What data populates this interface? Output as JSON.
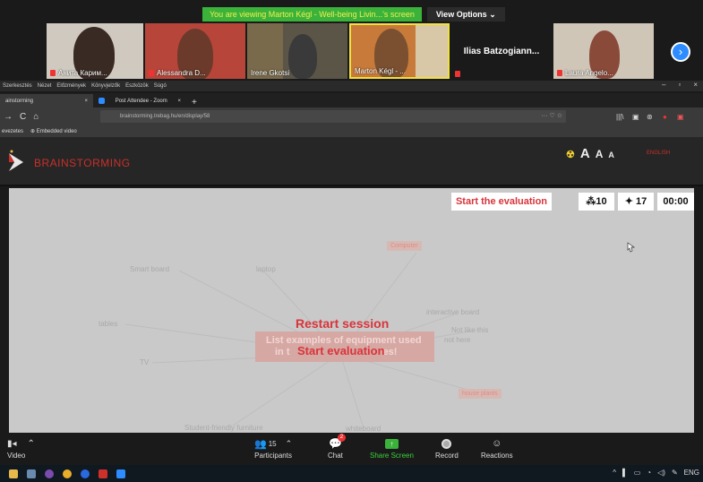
{
  "banner": {
    "viewing": "You are viewing Marton Kégl - Well-being Livin...'s screen",
    "options": "View Options ⌄"
  },
  "participants": [
    {
      "name": "Анита Карим..."
    },
    {
      "name": "Alessandra D..."
    },
    {
      "name": "Irene Gkotsi"
    },
    {
      "name": "Marton Kégl - ..."
    },
    {
      "name": "Ilias  Batzogiann..."
    },
    {
      "name": "Laura Angelo..."
    }
  ],
  "browser": {
    "menu": [
      "Szerkesztés",
      "Nézet",
      "Előzmények",
      "Könyvjelzők",
      "Eszközök",
      "Súgó"
    ],
    "tabs": [
      {
        "label": "ainstorming",
        "close": "×"
      },
      {
        "label": "Post Attendee - Zoom",
        "close": "×"
      }
    ],
    "new_tab": "+",
    "url": "brainstorming.trebag.hu/en/display/58",
    "url_right": "··· ♡ ☆",
    "bookmarks": [
      "evezetes",
      "Embedded video"
    ]
  },
  "app": {
    "title": "BRAINSTORMING",
    "font_sizes": [
      "A",
      "A",
      "A"
    ],
    "language": "ENGLISH"
  },
  "canvas": {
    "start_eval_button": "Start the evaluation",
    "stat_ideas": "⁂10",
    "stat_people": "✦ 17",
    "timer": "00:00",
    "words": {
      "computer": "Computer",
      "smart_board": "Smart board",
      "laptop": "laptop",
      "tables": "tables",
      "interactive_board": "interactive board",
      "not_like": "Not like this",
      "not_here": "not here",
      "tv": "TV",
      "house_plants": "house plants",
      "student_furniture": "Student-friendly furniture",
      "whiteboard": "whiteboard"
    },
    "restart": "Restart session",
    "prompt_line1": "List examples of equipment used",
    "prompt_line2": "in t",
    "prompt_line2_end": "es!",
    "start_center": "Start evaluation"
  },
  "toolbar": {
    "video": "Video",
    "participants": "Participants",
    "participants_count": "15",
    "chat": "Chat",
    "chat_badge": "2",
    "share": "Share Screen",
    "record": "Record",
    "reactions": "Reactions"
  },
  "taskbar": {
    "lang": "ENG"
  },
  "colors": {
    "accent_red": "#d9343a",
    "zoom_green": "#3bb33b",
    "zoom_blue": "#2d8cff"
  }
}
